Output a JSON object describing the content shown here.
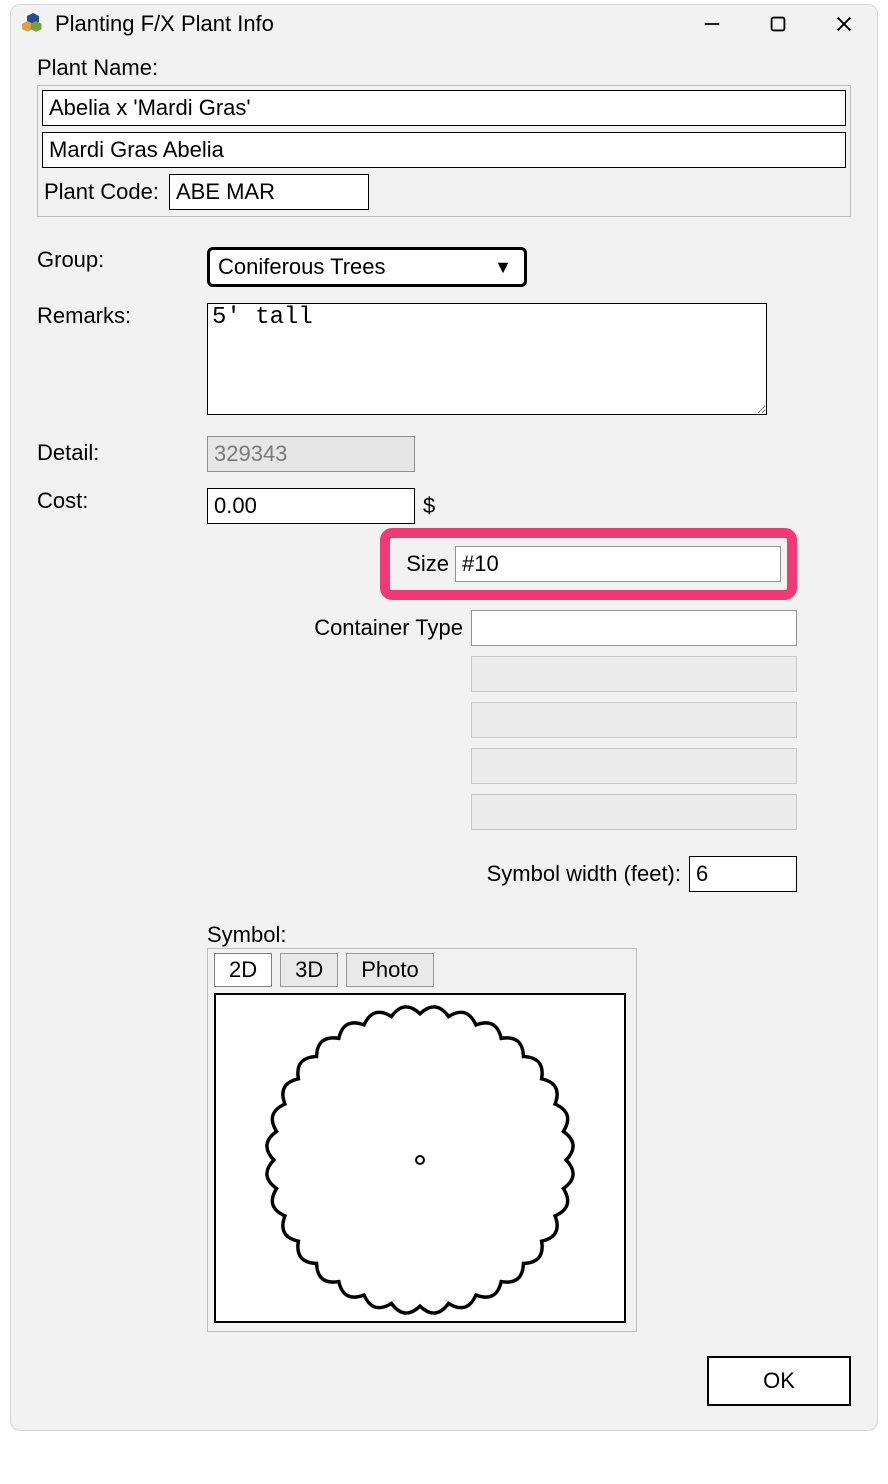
{
  "window": {
    "title": "Planting F/X Plant Info"
  },
  "plant_name": {
    "label": "Plant Name:",
    "scientific": "Abelia x 'Mardi Gras'",
    "common": "Mardi Gras Abelia",
    "code_label": "Plant Code:",
    "code": "ABE MAR"
  },
  "group": {
    "label": "Group:",
    "value": "Coniferous Trees"
  },
  "remarks": {
    "label": "Remarks:",
    "value": "5' tall"
  },
  "detail": {
    "label": "Detail:",
    "value": "329343"
  },
  "cost": {
    "label": "Cost:",
    "value": "0.00",
    "currency": "$"
  },
  "size": {
    "label": "Size",
    "value": "#10"
  },
  "container_type": {
    "label": "Container Type",
    "value": ""
  },
  "extra_fields": {
    "values": [
      "",
      "",
      "",
      ""
    ]
  },
  "symbol_width": {
    "label": "Symbol width (feet):",
    "value": "6"
  },
  "symbol": {
    "label": "Symbol:",
    "tabs": {
      "tab_2d": "2D",
      "tab_3d": "3D",
      "tab_photo": "Photo"
    }
  },
  "buttons": {
    "ok": "OK"
  },
  "highlight_color": "#ef3a75"
}
